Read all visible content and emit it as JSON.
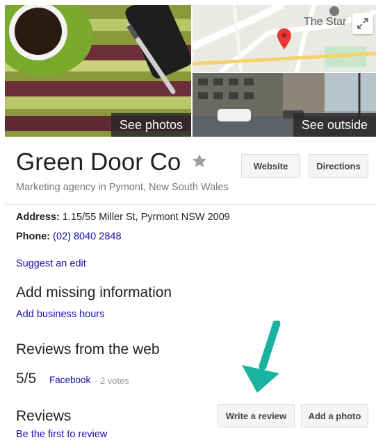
{
  "photos": {
    "see_photos_label": "See photos",
    "see_outside_label": "See outside",
    "map_place_label": "The Star"
  },
  "business": {
    "name": "Green Door Co",
    "category": "Marketing agency in Pymont, New South Wales",
    "website_label": "Website",
    "directions_label": "Directions",
    "address_label": "Address:",
    "address_value": "1.15/55 Miller St, Pyrmont NSW 2009",
    "phone_label": "Phone:",
    "phone_value": "(02) 8040 2848",
    "suggest_edit": "Suggest an edit"
  },
  "missing_info": {
    "heading": "Add missing information",
    "link": "Add business hours"
  },
  "web_reviews": {
    "heading": "Reviews from the web",
    "score": "5/5",
    "source": "Facebook",
    "votes": "· 2 votes"
  },
  "reviews": {
    "heading": "Reviews",
    "first_review": "Be the first to review",
    "write_review_label": "Write a review",
    "add_photo_label": "Add a photo"
  },
  "colors": {
    "link": "#1a0dab",
    "arrow": "#1ab3a0",
    "pin": "#e53935"
  }
}
